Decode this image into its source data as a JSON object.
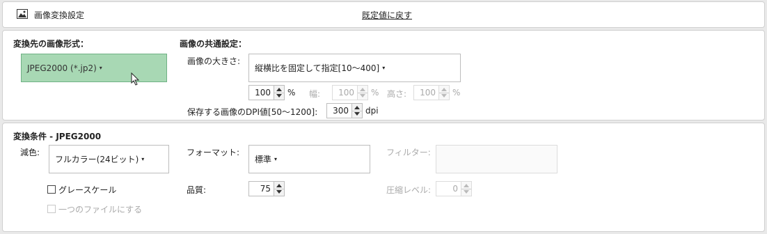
{
  "header": {
    "icon": "image-icon",
    "title": "画像変換設定",
    "reset_link": "既定値に戻す"
  },
  "format_section": {
    "heading": "変換先の画像形式：",
    "selected_format": "JPEG2000 (*.jp2)",
    "selected_bg": "#a8d8b4",
    "caret": "▾"
  },
  "common_section": {
    "heading": "画像の共通設定：",
    "size_label": "画像の大きさ:",
    "size_mode": "縦横比を固定して指定[10～400]",
    "caret": "▾",
    "percent_value": "100",
    "percent_unit": "%",
    "width_label": "幅:",
    "width_value": "100",
    "width_unit": "%",
    "height_label": "高さ:",
    "height_value": "100",
    "height_unit": "%",
    "dpi_label": "保存する画像のDPI値[50～1200]:",
    "dpi_value": "300",
    "dpi_unit": "dpi"
  },
  "conditions_section": {
    "heading": "変換条件 - JPEG2000",
    "reduce_label": "減色:",
    "reduce_value": "フルカラー(24ビット)",
    "format_label": "フォーマット:",
    "format_value": "標準",
    "filter_label": "フィルター:",
    "filter_value": "",
    "caret": "▾",
    "grayscale_label": "グレースケール",
    "grayscale_checked": false,
    "single_file_label": "一つのファイルにする",
    "single_file_checked": false,
    "quality_label": "品質:",
    "quality_value": "75",
    "compression_label": "圧縮レベル:",
    "compression_value": "0"
  }
}
